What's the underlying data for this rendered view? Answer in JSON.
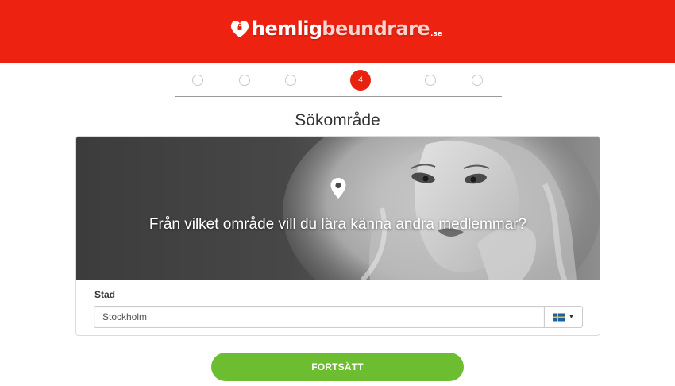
{
  "brand": {
    "name_part1": "hemlig",
    "name_part2": "beundrare",
    "tld": ".se",
    "accent": "#ee2211"
  },
  "progress": {
    "current_step_label": "4",
    "active_color": "#e8220f"
  },
  "page_title": "Sökområde",
  "hero": {
    "icon": "location-pin-icon",
    "question": "Från vilket område vill du lära känna andra medlemmar?"
  },
  "form": {
    "city_label": "Stad",
    "city_value": "Stockholm",
    "country_flag": "sweden-flag-icon",
    "country_caret": "chevron-down-icon"
  },
  "actions": {
    "continue_label": "FORTSÄTT",
    "continue_color": "#6cbd2f"
  }
}
